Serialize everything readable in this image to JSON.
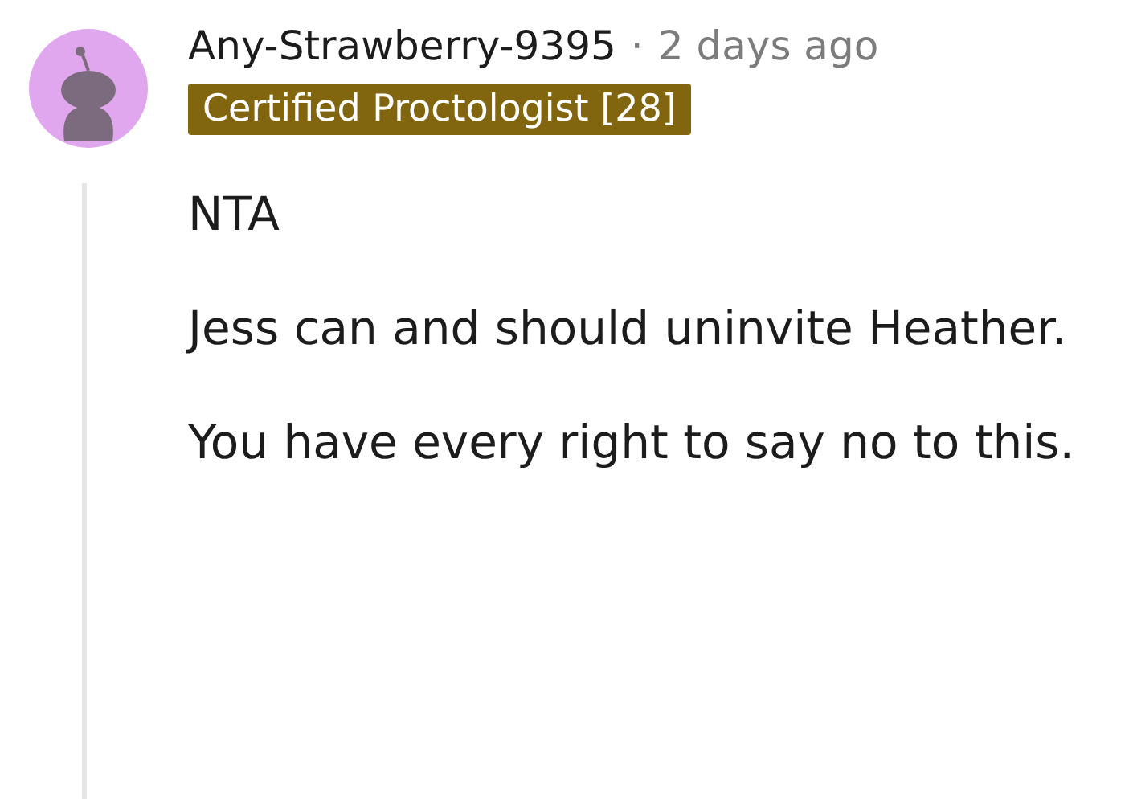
{
  "comment": {
    "author": "Any-Strawberry-9395",
    "separator": "·",
    "time": "2 days ago",
    "flair": "Certified Proctologist [28]",
    "paragraphs": [
      "NTA",
      "Jess can and should uninvite Heather.",
      "You have every right to say no to this."
    ]
  }
}
